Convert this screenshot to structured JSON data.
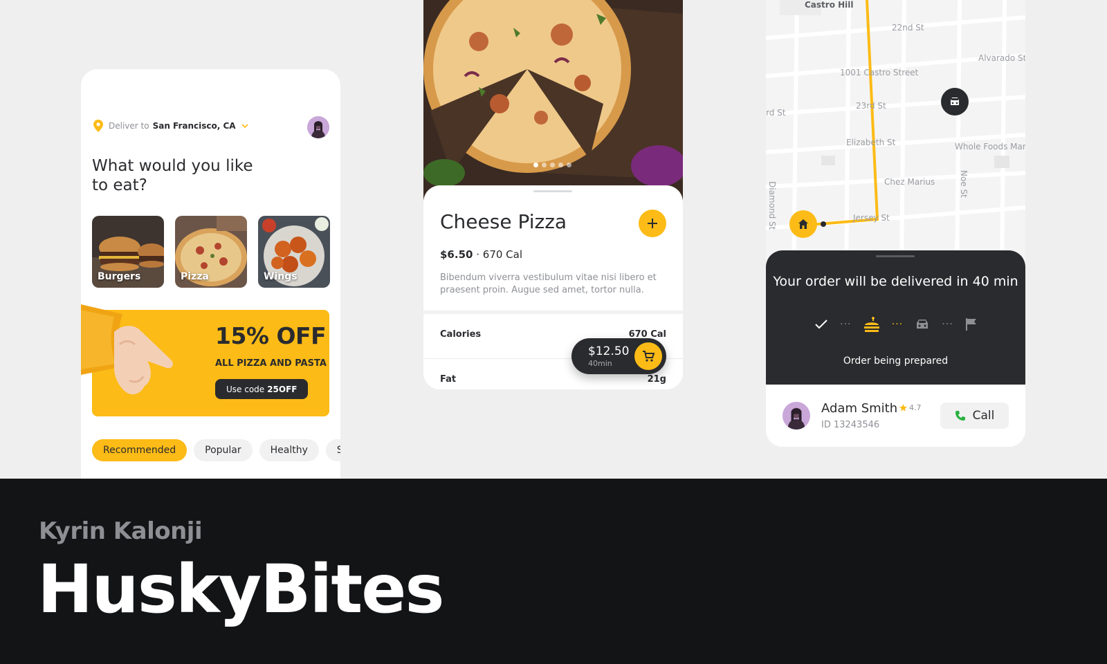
{
  "phone1": {
    "deliver_label": "Deliver to",
    "deliver_city": "San Francisco, CA",
    "headline": "What would you like to eat?",
    "categories": [
      {
        "label": "Burgers"
      },
      {
        "label": "Pizza"
      },
      {
        "label": "Wings"
      }
    ],
    "promo": {
      "discount": "15% OFF",
      "subtitle": "ALL PIZZA AND PASTA",
      "code_prefix": "Use code",
      "code": "25OFF"
    },
    "chips": [
      "Recommended",
      "Popular",
      "Healthy",
      "Sa"
    ]
  },
  "phone2": {
    "title": "Cheese Pizza",
    "price": "$6.50",
    "calories_short": "· 670 Cal",
    "description": "Bibendum viverra vestibulum vitae nisi libero et praesent proin. Augue sed amet, tortor nulla.",
    "nutrition": [
      {
        "label": "Calories",
        "value": "670 Cal"
      },
      {
        "label": "Fat",
        "value": "21g"
      }
    ],
    "cart": {
      "price": "$12.50",
      "time": "40min"
    },
    "carousel": {
      "count": 5,
      "active": 0
    }
  },
  "phone3": {
    "map_labels": {
      "castro_hill": "Castro Hill",
      "st22": "22nd St",
      "alvarado": "Alvarado St",
      "castro_street": "1001 Castro Street",
      "st23": "23rd St",
      "st23_left": "rd St",
      "elizabeth": "Elizabeth St",
      "whole_foods": "Whole Foods Mar",
      "diamond": "Diamond St",
      "noe": "Noe St",
      "chez": "Chez Marius",
      "jersey": "Jersey St"
    },
    "tracking": {
      "title": "Your order will be delivered in 40 min",
      "status": "Order being prepared"
    },
    "courier": {
      "name": "Adam Smith",
      "rating": "4.7",
      "id": "ID 13243546",
      "call_label": "Call"
    }
  },
  "banner": {
    "author": "Kyrin Kalonji",
    "title": "HuskyBites"
  },
  "colors": {
    "accent": "#fcbb16",
    "dark": "#2a2b2e",
    "background": "#efefef",
    "banner": "#131416"
  },
  "icons": [
    "location-pin-icon",
    "chevron-down-icon",
    "plus-icon",
    "cart-icon",
    "car-icon",
    "home-icon",
    "check-icon",
    "food-icon",
    "flag-icon",
    "phone-icon",
    "star-icon"
  ]
}
